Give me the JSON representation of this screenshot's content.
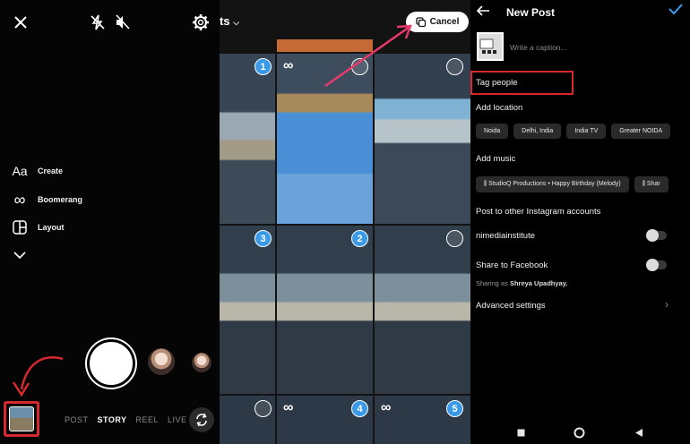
{
  "camera": {
    "side_menu": [
      {
        "label": "Create",
        "icon": "text-aa-icon",
        "glyph": "Aa"
      },
      {
        "label": "Boomerang",
        "icon": "infinity-icon",
        "glyph": "∞"
      },
      {
        "label": "Layout",
        "icon": "layout-grid-icon",
        "glyph": ""
      }
    ],
    "modes": [
      "POST",
      "STORY",
      "REEL",
      "LIVE"
    ],
    "active_mode": "STORY"
  },
  "gallery": {
    "header_label": "ts",
    "cancel_label": "Cancel",
    "badges": [
      "1",
      "2",
      "3",
      "4",
      "5"
    ]
  },
  "new_post": {
    "title": "New Post",
    "caption_placeholder": "Write a caption...",
    "tag_people": "Tag people",
    "add_location": "Add location",
    "locations": [
      "Noida",
      "Delhi, India",
      "India TV",
      "Greater NOIDA"
    ],
    "add_music": "Add music",
    "music": [
      "StudioQ Productions • Happy Birthday (Melody)",
      "Shar"
    ],
    "post_to_other": "Post to other Instagram accounts",
    "account": "nimediainstitute",
    "share_facebook": "Share to Facebook",
    "sharing_as_prefix": "Sharing as",
    "sharing_as_name": "Shreya Upadhyay.",
    "advanced_settings": "Advanced settings"
  },
  "colors": {
    "accent": "#3a9ae8",
    "highlight": "#d8282f"
  }
}
